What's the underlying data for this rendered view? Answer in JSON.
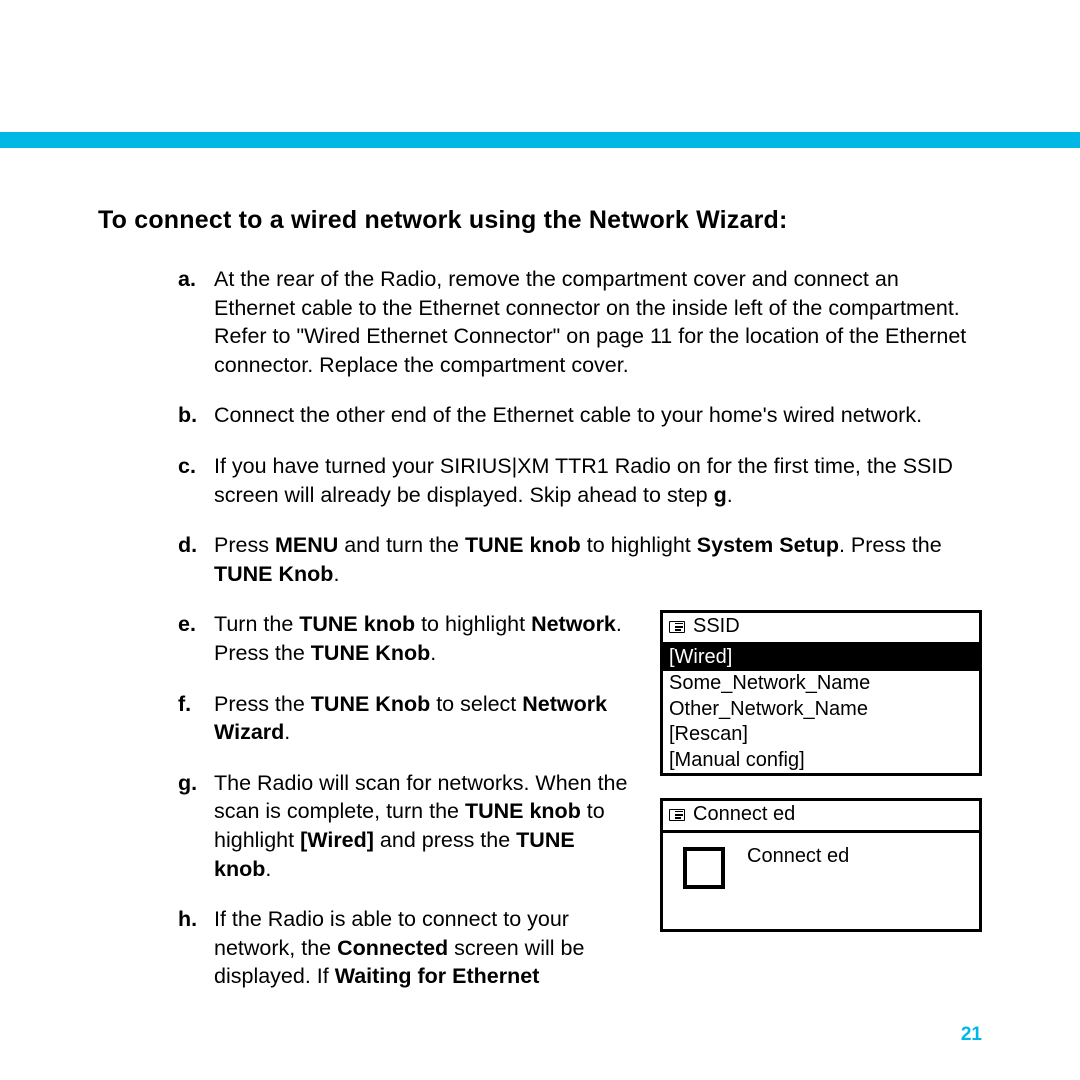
{
  "colors": {
    "accent": "#00b8e6"
  },
  "heading": "To connect to a wired network using the Network Wizard:",
  "steps": {
    "a": {
      "marker": "a.",
      "text_pre": "At the rear of the Radio, remove the compartment cover and connect an Ethernet cable to the Ethernet connector on the inside left of the compartment. Refer to \"Wired Ethernet Connector\" on page 11 for the location of the Ethernet connector. Replace the compartment cover."
    },
    "b": {
      "marker": "b.",
      "text_pre": "Connect the other end of the Ethernet cable to your home's wired network."
    },
    "c": {
      "marker": "c.",
      "pre": "If you have turned your SIRIUS|XM TTR1 Radio on for the first time, the SSID screen will already be displayed. Skip ahead to step ",
      "bold": "g",
      "post": "."
    },
    "d": {
      "marker": "d.",
      "pre": "Press ",
      "b1": "MENU",
      "mid1": " and turn the ",
      "b2": "TUNE knob",
      "mid2": " to highlight ",
      "b3": "System Setup",
      "mid3": ". Press the ",
      "b4": "TUNE Knob",
      "post": "."
    },
    "e": {
      "marker": "e.",
      "pre": "Turn the ",
      "b1": "TUNE knob",
      "mid1": " to highlight ",
      "b2": "Network",
      "mid2": ". Press the ",
      "b3": "TUNE Knob",
      "post": "."
    },
    "f": {
      "marker": "f.",
      "pre": "Press the ",
      "b1": "TUNE Knob",
      "mid1": " to select ",
      "b2": "Network Wizard",
      "post": "."
    },
    "g": {
      "marker": "g.",
      "pre": "The Radio will scan for networks. When the scan is complete, turn the ",
      "b1": "TUNE knob",
      "mid1": " to highlight ",
      "b2": "[Wired]",
      "mid2": " and press the ",
      "b3": "TUNE knob",
      "post": "."
    },
    "h": {
      "marker": "h.",
      "pre": "If the Radio is able to connect to your network, the ",
      "b1": "Connected",
      "mid1": " screen will be displayed. If ",
      "b2": "Waiting for Ethernet"
    }
  },
  "ssid_screen": {
    "title": "SSID",
    "rows": [
      {
        "label": "[Wired]",
        "selected": true
      },
      {
        "label": "Some_Network_Name",
        "selected": false
      },
      {
        "label": "Other_Network_Name",
        "selected": false
      },
      {
        "label": "[Rescan]",
        "selected": false
      },
      {
        "label": "[Manual config]",
        "selected": false
      }
    ]
  },
  "connected_screen": {
    "title": "Connect ed",
    "body": "Connect ed"
  },
  "page_number": "21"
}
